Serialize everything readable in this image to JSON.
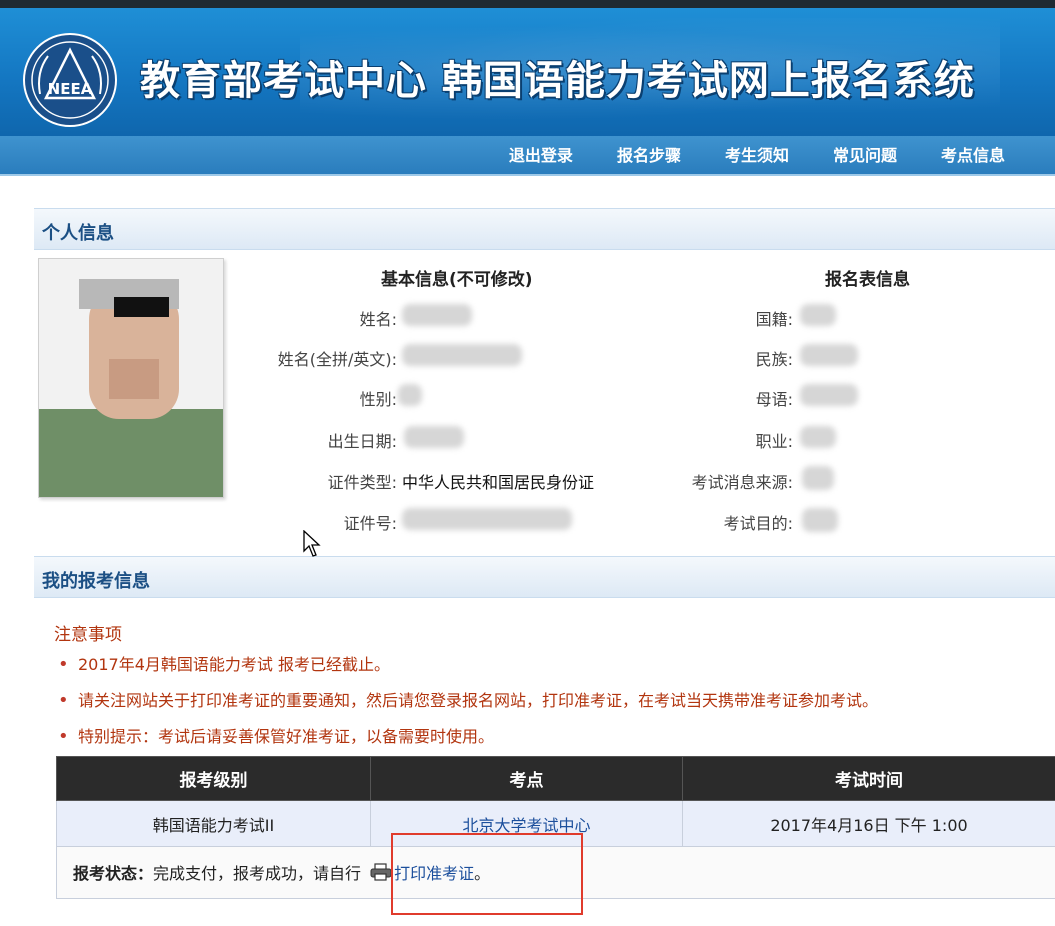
{
  "header": {
    "logo_text": "NEEA",
    "title": "教育部考试中心  韩国语能力考试网上报名系统"
  },
  "nav": [
    {
      "label": "退出登录"
    },
    {
      "label": "报名步骤"
    },
    {
      "label": "考生须知"
    },
    {
      "label": "常见问题"
    },
    {
      "label": "考点信息"
    }
  ],
  "personal": {
    "section_title": "个人信息",
    "basic_title": "基本信息(不可修改)",
    "form_title": "报名表信息",
    "basic_fields": [
      {
        "label": "姓名:",
        "value": ""
      },
      {
        "label": "姓名(全拼/英文):",
        "value": ""
      },
      {
        "label": "性别:",
        "value": ""
      },
      {
        "label": "出生日期:",
        "value": ""
      },
      {
        "label": "证件类型:",
        "value": "中华人民共和国居民身份证"
      },
      {
        "label": "证件号:",
        "value": ""
      }
    ],
    "form_fields": [
      {
        "label": "国籍:",
        "value": ""
      },
      {
        "label": "民族:",
        "value": ""
      },
      {
        "label": "母语:",
        "value": ""
      },
      {
        "label": "职业:",
        "value": ""
      },
      {
        "label": "考试消息来源:",
        "value": ""
      },
      {
        "label": "考试目的:",
        "value": ""
      }
    ]
  },
  "registration": {
    "section_title": "我的报考信息",
    "notice_title": "注意事项",
    "notices": [
      "2017年4月韩国语能力考试 报考已经截止。",
      "请关注网站关于打印准考证的重要通知，然后请您登录报名网站，打印准考证，在考试当天携带准考证参加考试。",
      "特别提示：考试后请妥善保管好准考证，以备需要时使用。"
    ],
    "table": {
      "headers": [
        "报考级别",
        "考点",
        "考试时间"
      ],
      "row": {
        "level": "韩国语能力考试II",
        "center": "北京大学考试中心",
        "time": "2017年4月16日 下午 1:00"
      },
      "status_label": "报考状态：",
      "status_text": "完成支付，报考成功，请自行",
      "print_link": "打印准考证",
      "status_end": "。"
    }
  },
  "colors": {
    "header_blue": "#1477c2",
    "nav_blue": "#2a7dbd",
    "notice_red": "#b2350f",
    "link_blue": "#1c4f9c",
    "highlight_red": "#e03b2c"
  }
}
